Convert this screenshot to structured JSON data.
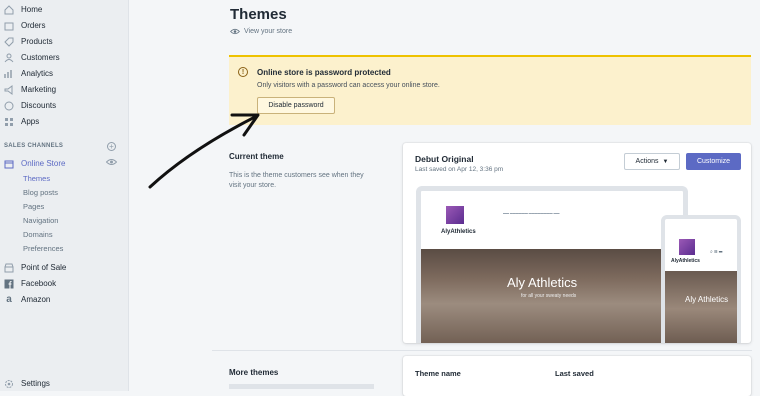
{
  "sidebar": {
    "items": [
      {
        "label": "Home",
        "icon": "home-icon"
      },
      {
        "label": "Orders",
        "icon": "orders-icon"
      },
      {
        "label": "Products",
        "icon": "products-icon"
      },
      {
        "label": "Customers",
        "icon": "customers-icon"
      },
      {
        "label": "Analytics",
        "icon": "analytics-icon"
      },
      {
        "label": "Marketing",
        "icon": "marketing-icon"
      },
      {
        "label": "Discounts",
        "icon": "discounts-icon"
      },
      {
        "label": "Apps",
        "icon": "apps-icon"
      }
    ],
    "sales_channels_label": "SALES CHANNELS",
    "online_store": "Online Store",
    "sub_items": [
      "Themes",
      "Blog posts",
      "Pages",
      "Navigation",
      "Domains",
      "Preferences"
    ],
    "channels": [
      {
        "label": "Point of Sale",
        "icon": "store-icon"
      },
      {
        "label": "Facebook",
        "icon": "facebook-icon"
      },
      {
        "label": "Amazon",
        "icon": "amazon-icon"
      }
    ],
    "settings": "Settings"
  },
  "header": {
    "title": "Themes",
    "view_store": "View your store"
  },
  "banner": {
    "title": "Online store is password protected",
    "text": "Only visitors with a password can access your online store.",
    "button": "Disable password"
  },
  "current_theme": {
    "title": "Current theme",
    "desc": "This is the theme customers see when they visit your store.",
    "name": "Debut Original",
    "saved": "Last saved on Apr 12, 3:36 pm",
    "actions": "Actions",
    "customize": "Customize",
    "preview_brand": "AlyAthletics",
    "preview_hero": "Aly Athletics",
    "preview_sub": "for all your sweaty needs"
  },
  "more_themes": {
    "title": "More themes",
    "col_name": "Theme name",
    "col_saved": "Last saved"
  },
  "colors": {
    "accent": "#5c6ac4",
    "banner": "#fcf1cd",
    "banner_border": "#eec200"
  }
}
